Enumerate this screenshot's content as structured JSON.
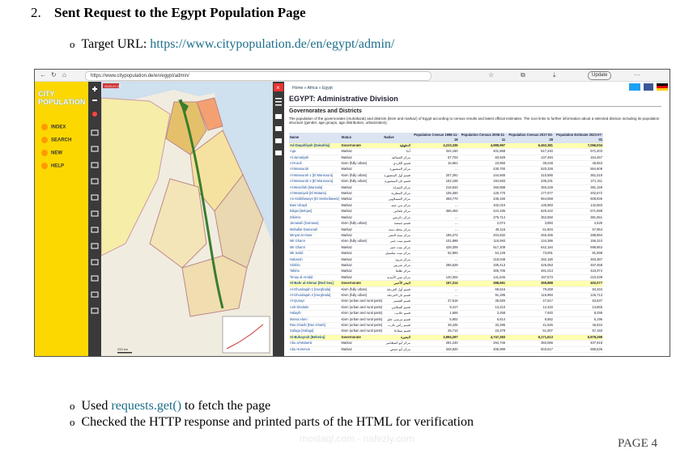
{
  "heading": {
    "number": "2.",
    "title": "Sent Request to the Egypt Population Page"
  },
  "target": {
    "label": "Target URL: ",
    "url": "https://www.citypopulation.de/en/egypt/admin/"
  },
  "bullets": [
    {
      "pre": "Used ",
      "code": "requests.get()",
      "post": " to fetch the page"
    },
    {
      "pre": "Checked the HTTP response and printed parts of the HTML for verification",
      "code": "",
      "post": ""
    }
  ],
  "page_number": "PAGE 4",
  "watermark": "mostaql.com · nafezly.com",
  "screenshot": {
    "browser": {
      "url": "https://www.citypopulation.de/en/egypt/admin/",
      "update_label": "Update"
    },
    "sidebar": {
      "logo": "CITY POPULATION",
      "menu": [
        "INDEX",
        "SEARCH",
        "NEW",
        "HELP"
      ]
    },
    "map": {
      "date_tag": "2023-07-01",
      "scale": "200 km"
    },
    "content": {
      "breadcrumb": "Home » Africa » Egypt",
      "title": "EGYPT: Administrative Division",
      "subtitle": "Governorates and Districts",
      "description": "The population of the governorates (muhafazat) and districts (kism and markaz) of Egypt according to census results and latest official estimates. The icon links to further information about a selected division including its population structure (gender, age groups, age distribution, urbanization).",
      "columns": [
        "Name",
        "Status",
        "Native",
        "Population Census 1996-11-19",
        "Population Census 2006-11-11",
        "Population Census 2017-03-28",
        "Population Estimate 2023-07-01"
      ],
      "rows": [
        {
          "gov": true,
          "name": "Ad-Daqahliyah [Dakahlia]",
          "status": "Governorate",
          "native": "الدقهلية",
          "p1": "4,223,336",
          "p2": "4,989,997",
          "p3": "6,492,381",
          "p4": "7,066,004"
        },
        {
          "name": "Aga",
          "status": "Markaz",
          "native": "أجا",
          "p1": "344,160",
          "p2": "401,868",
          "p3": "517,240",
          "p4": "571,403"
        },
        {
          "name": "Al-Jamaliyah",
          "status": "Markaz",
          "native": "مركز الجمالية",
          "p1": "67,703",
          "p2": "83,929",
          "p3": "137,494",
          "p4": "154,457"
        },
        {
          "name": "Al-Kurdi",
          "status": "Kism (fully urban)",
          "native": "قسم الكردي",
          "p1": "15,561",
          "p2": "23,950",
          "p3": "39,248",
          "p4": "45,653"
        },
        {
          "name": "Al-Mansurah",
          "status": "Markaz",
          "native": "مركز المنصورة",
          "p1": "...",
          "p2": "430,700",
          "p3": "520,328",
          "p4": "554,608"
        },
        {
          "name": "Al-Mansurah 1 [El Mansoura]",
          "status": "Kism (fully urban)",
          "native": "قسم أول المنصورة",
          "p1": "207,291",
          "p2": "244,665",
          "p3": "310,590",
          "p4": "361,019"
        },
        {
          "name": "Al-Mansurah 2 [El Mansoura]",
          "status": "Kism (fully urban)",
          "native": "قسم ثان المنصورة",
          "p1": "162,158",
          "p2": "194,683",
          "p3": "235,231",
          "p4": "271,311"
        },
        {
          "name": "Al-Manzilah [Manzala]",
          "status": "Markaz",
          "native": "مركز المنزلة",
          "p1": "218,533",
          "p2": "260,888",
          "p3": "350,249",
          "p4": "391,159"
        },
        {
          "name": "Al-Matariyah [El Mataria]",
          "status": "Markaz",
          "native": "مركز المطرية",
          "p1": "105,260",
          "p2": "125,770",
          "p3": "177,577",
          "p4": "202,672"
        },
        {
          "name": "As-Sinbillawayn [El Senbellawein]",
          "status": "Markaz",
          "native": "مركز السنبلاوين",
          "p1": "368,770",
          "p2": "435,155",
          "p3": "564,558",
          "p4": "608,836"
        },
        {
          "name": "Bani Ubayd",
          "status": "Markaz",
          "native": "مركز بني عبيد",
          "p1": "...",
          "p2": "102,016",
          "p3": "130,983",
          "p4": "142,560"
        },
        {
          "name": "Bilqas [Belqas]",
          "status": "Markaz",
          "native": "مركز بلقاس",
          "p1": "365,464",
          "p2": "424,185",
          "p3": "529,442",
          "p4": "571,698"
        },
        {
          "name": "Dikirnis",
          "status": "Markaz",
          "native": "مركز دكرنس",
          "p1": "...",
          "p2": "276,714",
          "p3": "352,550",
          "p4": "381,651"
        },
        {
          "name": "Jamasah [Gamasa]",
          "status": "Kism (fully urban)",
          "native": "قسم جمصة",
          "p1": "...",
          "p2": "2,074",
          "p3": "3,893",
          "p4": "4,525"
        },
        {
          "name": "Mahallat Damanah",
          "status": "Markaz",
          "native": "مركز محلة دمنة",
          "p1": "...",
          "p2": "46,116",
          "p3": "61,504",
          "p4": "67,954"
        },
        {
          "name": "Minyat an-Nasr",
          "status": "Markaz",
          "native": "مركز منية النصر",
          "p1": "185,273",
          "p2": "204,932",
          "p3": "266,465",
          "p4": "288,994"
        },
        {
          "name": "Mit Ghamr",
          "status": "Kism (fully urban)",
          "native": "قسم ميت غمر",
          "p1": "101,899",
          "p2": "115,593",
          "p3": "134,386",
          "p4": "156,310"
        },
        {
          "name": "Mit Ghamr",
          "status": "Markaz",
          "native": "مركز ميت غمر",
          "p1": "428,309",
          "p2": "517,209",
          "p3": "642,184",
          "p4": "698,863"
        },
        {
          "name": "Mit Salsil",
          "status": "Markaz",
          "native": "مركز ميت سلسيل",
          "p1": "52,993",
          "p2": "54,129",
          "p3": "73,001",
          "p4": "81,598"
        },
        {
          "name": "Nabaruh",
          "status": "Markaz",
          "native": "مركز نبروه",
          "p1": "...",
          "p2": "219,048",
          "p3": "282,180",
          "p4": "303,387"
        },
        {
          "name": "Shirbin",
          "status": "Markaz",
          "native": "مركز شربين",
          "p1": "286,529",
          "p2": "336,413",
          "p3": "426,053",
          "p4": "457,458"
        },
        {
          "name": "Talkha",
          "status": "Markaz",
          "native": "مركز طلخا",
          "p1": "...",
          "p2": "305,705",
          "p3": "391,013",
          "p4": "423,374"
        },
        {
          "name": "Timay al-Amdid",
          "status": "Markaz",
          "native": "مركز تمي الأمديد",
          "p1": "120,304",
          "p2": "141,646",
          "p3": "197,573",
          "p4": "210,439"
        },
        {
          "gov": true,
          "name": "Al-Bahr al-Ahmar [Red Sea]",
          "status": "Governorate",
          "native": "البحر الأحمر",
          "p1": "157,314",
          "p2": "288,661",
          "p3": "359,888",
          "p4": "402,077"
        },
        {
          "name": "Al-Ghurdaqah 1 [Hurghada]",
          "status": "Kism (fully urban)",
          "native": "قسم أول الغردقة",
          "p1": "...",
          "p2": "69,616",
          "p3": "79,259",
          "p4": "84,334"
        },
        {
          "name": "Al-Ghurdaqah 2 [Hurghada]",
          "status": "Kism (fully urban)",
          "native": "قسم ثان الغردقة",
          "p1": "...",
          "p2": "91,285",
          "p3": "115,993",
          "p4": "126,713"
        },
        {
          "name": "Al-Qusayr",
          "status": "Kism (urban and rural parts)",
          "native": "قسم القصير",
          "p1": "27,618",
          "p2": "35,920",
          "p3": "47,817",
          "p4": "53,637"
        },
        {
          "name": "Ash-Shalatin",
          "status": "Kism (urban and rural parts)",
          "native": "قسم الشلاتين",
          "p1": "9,417",
          "p2": "13,210",
          "p3": "12,433",
          "p4": "13,865"
        },
        {
          "name": "Halayib",
          "status": "Kism (urban and rural parts)",
          "native": "قسم حلايب",
          "p1": "1,668",
          "p2": "2,268",
          "p3": "7,920",
          "p4": "8,259"
        },
        {
          "name": "Marsa Alam",
          "status": "Kism (urban and rural parts)",
          "native": "قسم مرسى علم",
          "p1": "5,902",
          "p2": "6,614",
          "p3": "8,552",
          "p4": "5,196"
        },
        {
          "name": "Ras Gharib [Ras Gharb]",
          "status": "Kism (urban and rural parts)",
          "native": "قسم رأس غارب",
          "p1": "28,425",
          "p2": "32,285",
          "p3": "41,526",
          "p4": "46,534"
        },
        {
          "name": "Safaga [Safaga]",
          "status": "Kism (urban and rural parts)",
          "native": "قسم سفاجا",
          "p1": "26,713",
          "p2": "23,379",
          "p3": "51,007",
          "p4": "57,150"
        },
        {
          "gov": true,
          "name": "Al-Buhayrah [Beheira]",
          "status": "Governorate",
          "native": "البحيرة",
          "p1": "3,994,297",
          "p2": "4,747,283",
          "p3": "6,171,613",
          "p4": "6,878,289"
        },
        {
          "name": "Abu al-Matamir",
          "status": "Markaz",
          "native": "مركز أبو المطامير",
          "p1": "291,240",
          "p2": "294,746",
          "p3": "350,066",
          "p4": "407,918"
        },
        {
          "name": "Abu Hummus",
          "status": "Markaz",
          "native": "مركز أبو حمص",
          "p1": "348,920",
          "p2": "405,999",
          "p3": "503,617",
          "p4": "555,536"
        }
      ]
    }
  }
}
